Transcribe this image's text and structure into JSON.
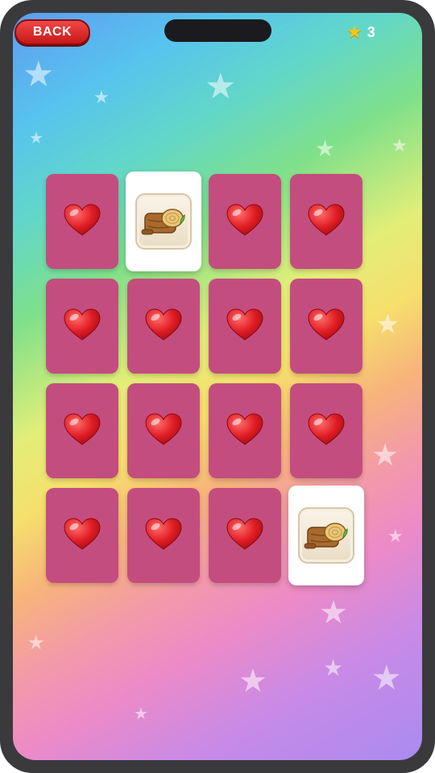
{
  "header": {
    "back_label": "BACK",
    "score_icon": "star-icon",
    "score_value": "3"
  },
  "board": {
    "rows": 4,
    "columns": 4,
    "cards": [
      {
        "state": "face-down",
        "icon": "heart-icon"
      },
      {
        "state": "face-up",
        "icon": "log-icon"
      },
      {
        "state": "face-down",
        "icon": "heart-icon"
      },
      {
        "state": "face-down",
        "icon": "heart-icon"
      },
      {
        "state": "face-down",
        "icon": "heart-icon"
      },
      {
        "state": "face-down",
        "icon": "heart-icon"
      },
      {
        "state": "face-down",
        "icon": "heart-icon"
      },
      {
        "state": "face-down",
        "icon": "heart-icon"
      },
      {
        "state": "face-down",
        "icon": "heart-icon"
      },
      {
        "state": "face-down",
        "icon": "heart-icon"
      },
      {
        "state": "face-down",
        "icon": "heart-icon"
      },
      {
        "state": "face-down",
        "icon": "heart-icon"
      },
      {
        "state": "face-down",
        "icon": "heart-icon"
      },
      {
        "state": "face-down",
        "icon": "heart-icon"
      },
      {
        "state": "face-down",
        "icon": "heart-icon"
      },
      {
        "state": "face-up",
        "icon": "log-icon"
      }
    ]
  },
  "colors": {
    "card_back": "#c44d7f",
    "card_front": "#ffffff",
    "heart": "#e01c24",
    "back_button": "#d92020",
    "star": "#f5c518"
  }
}
